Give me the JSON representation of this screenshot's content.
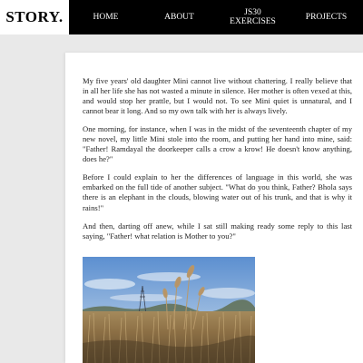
{
  "header": {
    "logo": "STORY.",
    "nav": {
      "home": "HOME",
      "about": "ABOUT",
      "js30_line1": "JS30",
      "js30_line2": "EXERCISES",
      "projects": "PROJECTS"
    }
  },
  "article": {
    "paragraphs": [
      "My five years' old daughter Mini cannot live without chattering. I really believe that in all her life she has not wasted a minute in silence. Her mother is often vexed at this, and would stop her prattle, but I would not. To see Mini quiet is unnatural, and I cannot bear it long. And so my own talk with her is always lively.",
      "One morning, for instance, when I was in the midst of the seventeenth chapter of my new novel, my little Mini stole into the room, and putting her hand into mine, said: \"Father! Ramdayal the doorkeeper calls a crow a krow! He doesn't know anything, does he?\"",
      "Before I could explain to her the differences of language in this world, she was embarked on the full tide of another subject. \"What do you think, Father? Bhola says there is an elephant in the clouds, blowing water out of his trunk, and that is why it rains!\"",
      "And then, darting off anew, while I sat still making ready some reply to this last saying, \"Father! what relation is Mother to you?\""
    ]
  },
  "colors": {
    "header_bg": "#000000",
    "nav_text": "#ffffff",
    "page_bg": "#e9e9e9",
    "card_bg": "#ffffff"
  }
}
